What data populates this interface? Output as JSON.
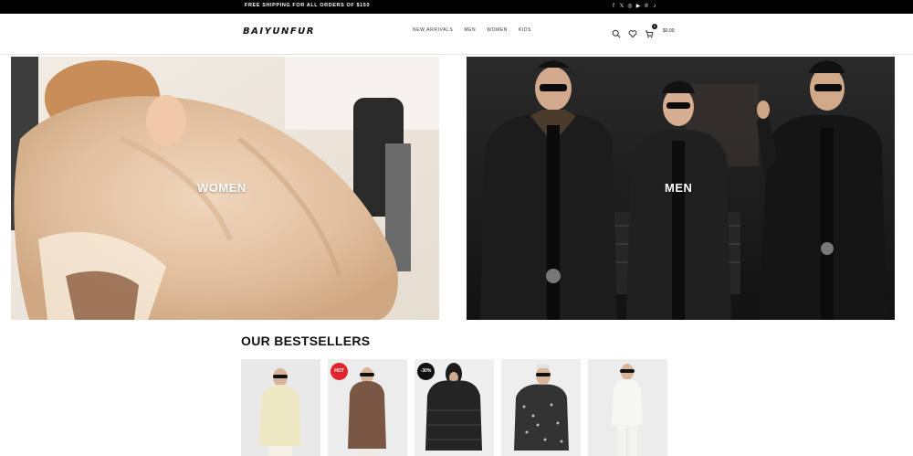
{
  "topbar": {
    "promo": "FREE SHIPPING FOR ALL ORDERS OF $150",
    "socials": [
      "facebook-icon",
      "x-icon",
      "instagram-icon",
      "youtube-icon",
      "pinterest-icon",
      "tiktok-icon"
    ]
  },
  "header": {
    "logo": "BAIYUNFUR",
    "menu": [
      "NEW ARRIVALS",
      "MEN",
      "WOMEN",
      "KIDS"
    ],
    "cart": {
      "count": "0",
      "total": "$0.00"
    }
  },
  "banners": [
    {
      "label": "WOMEN"
    },
    {
      "label": "MEN"
    }
  ],
  "bestsellers": {
    "title": "OUR BESTSELLERS",
    "products": [
      {
        "badge": "",
        "color": "#f0ebd0"
      },
      {
        "badge": "HOT",
        "color": "#7a5a45"
      },
      {
        "badge": "-30%",
        "color": "#2b2b2b"
      },
      {
        "badge": "",
        "color": "#3a3a3a"
      },
      {
        "badge": "",
        "color": "#f1f1ef"
      }
    ]
  }
}
